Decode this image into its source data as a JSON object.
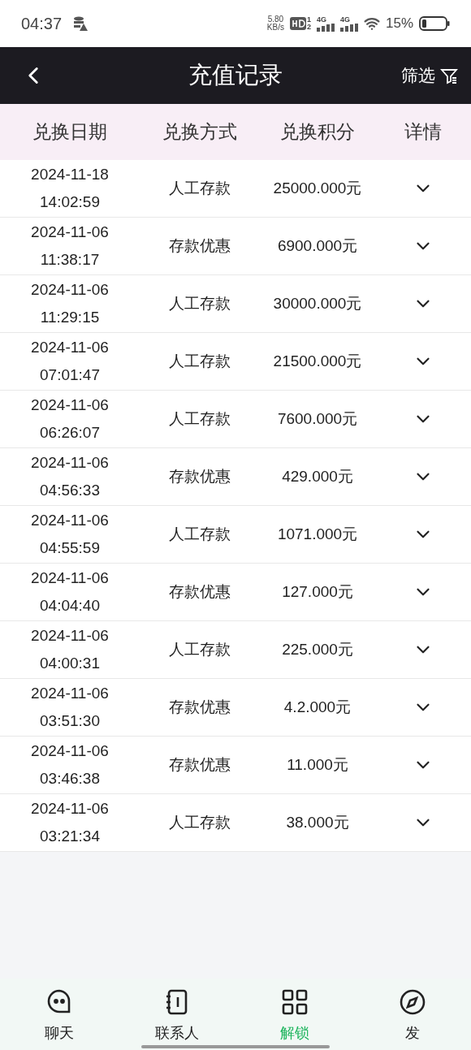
{
  "status_bar": {
    "time": "04:37",
    "speed_value": "5.80",
    "speed_unit": "KB/s",
    "hd_sim1": "1",
    "hd_sim2": "2",
    "network1": "4G",
    "network2": "4G",
    "battery": "15%"
  },
  "header": {
    "title": "充值记录",
    "filter": "筛选"
  },
  "table": {
    "columns": [
      "兑换日期",
      "兑换方式",
      "兑换积分",
      "详情"
    ],
    "rows": [
      {
        "date": "2024-11-18",
        "time": "14:02:59",
        "method": "人工存款",
        "amount": "25000.000元",
        "expanded": false
      },
      {
        "date": "2024-11-06",
        "time": "11:38:17",
        "method": "存款优惠",
        "amount": "6900.000元",
        "expanded": false
      },
      {
        "date": "2024-11-06",
        "time": "11:29:15",
        "method": "人工存款",
        "amount": "30000.000元",
        "expanded": false
      },
      {
        "date": "2024-11-06",
        "time": "07:01:47",
        "method": "人工存款",
        "amount": "21500.000元",
        "expanded": false
      },
      {
        "date": "2024-11-06",
        "time": "06:26:07",
        "method": "人工存款",
        "amount": "7600.000元",
        "expanded": false
      },
      {
        "date": "2024-11-06",
        "time": "04:56:33",
        "method": "存款优惠",
        "amount": "429.000元",
        "expanded": false
      },
      {
        "date": "2024-11-06",
        "time": "04:55:59",
        "method": "人工存款",
        "amount": "1071.000元",
        "expanded": false
      },
      {
        "date": "2024-11-06",
        "time": "04:04:40",
        "method": "存款优惠",
        "amount": "127.000元",
        "expanded": false
      },
      {
        "date": "2024-11-06",
        "time": "04:00:31",
        "method": "人工存款",
        "amount": "225.000元",
        "expanded": false
      },
      {
        "date": "2024-11-06",
        "time": "03:51:30",
        "method": "存款优惠",
        "amount": "4.2.000元",
        "expanded": false
      },
      {
        "date": "2024-11-06",
        "time": "03:46:38",
        "method": "存款优惠",
        "amount": "11.000元",
        "expanded": false
      },
      {
        "date": "2024-11-06",
        "time": "03:21:34",
        "method": "人工存款",
        "amount": "38.000元",
        "expanded": false
      }
    ]
  },
  "bottom_nav": [
    {
      "kind": "chat",
      "label": "聊天",
      "selected": false
    },
    {
      "kind": "contacts",
      "label": "联系人",
      "selected": false
    },
    {
      "kind": "grid",
      "label": "解锁",
      "selected": true
    },
    {
      "kind": "discover",
      "label": "发",
      "selected": false
    }
  ]
}
